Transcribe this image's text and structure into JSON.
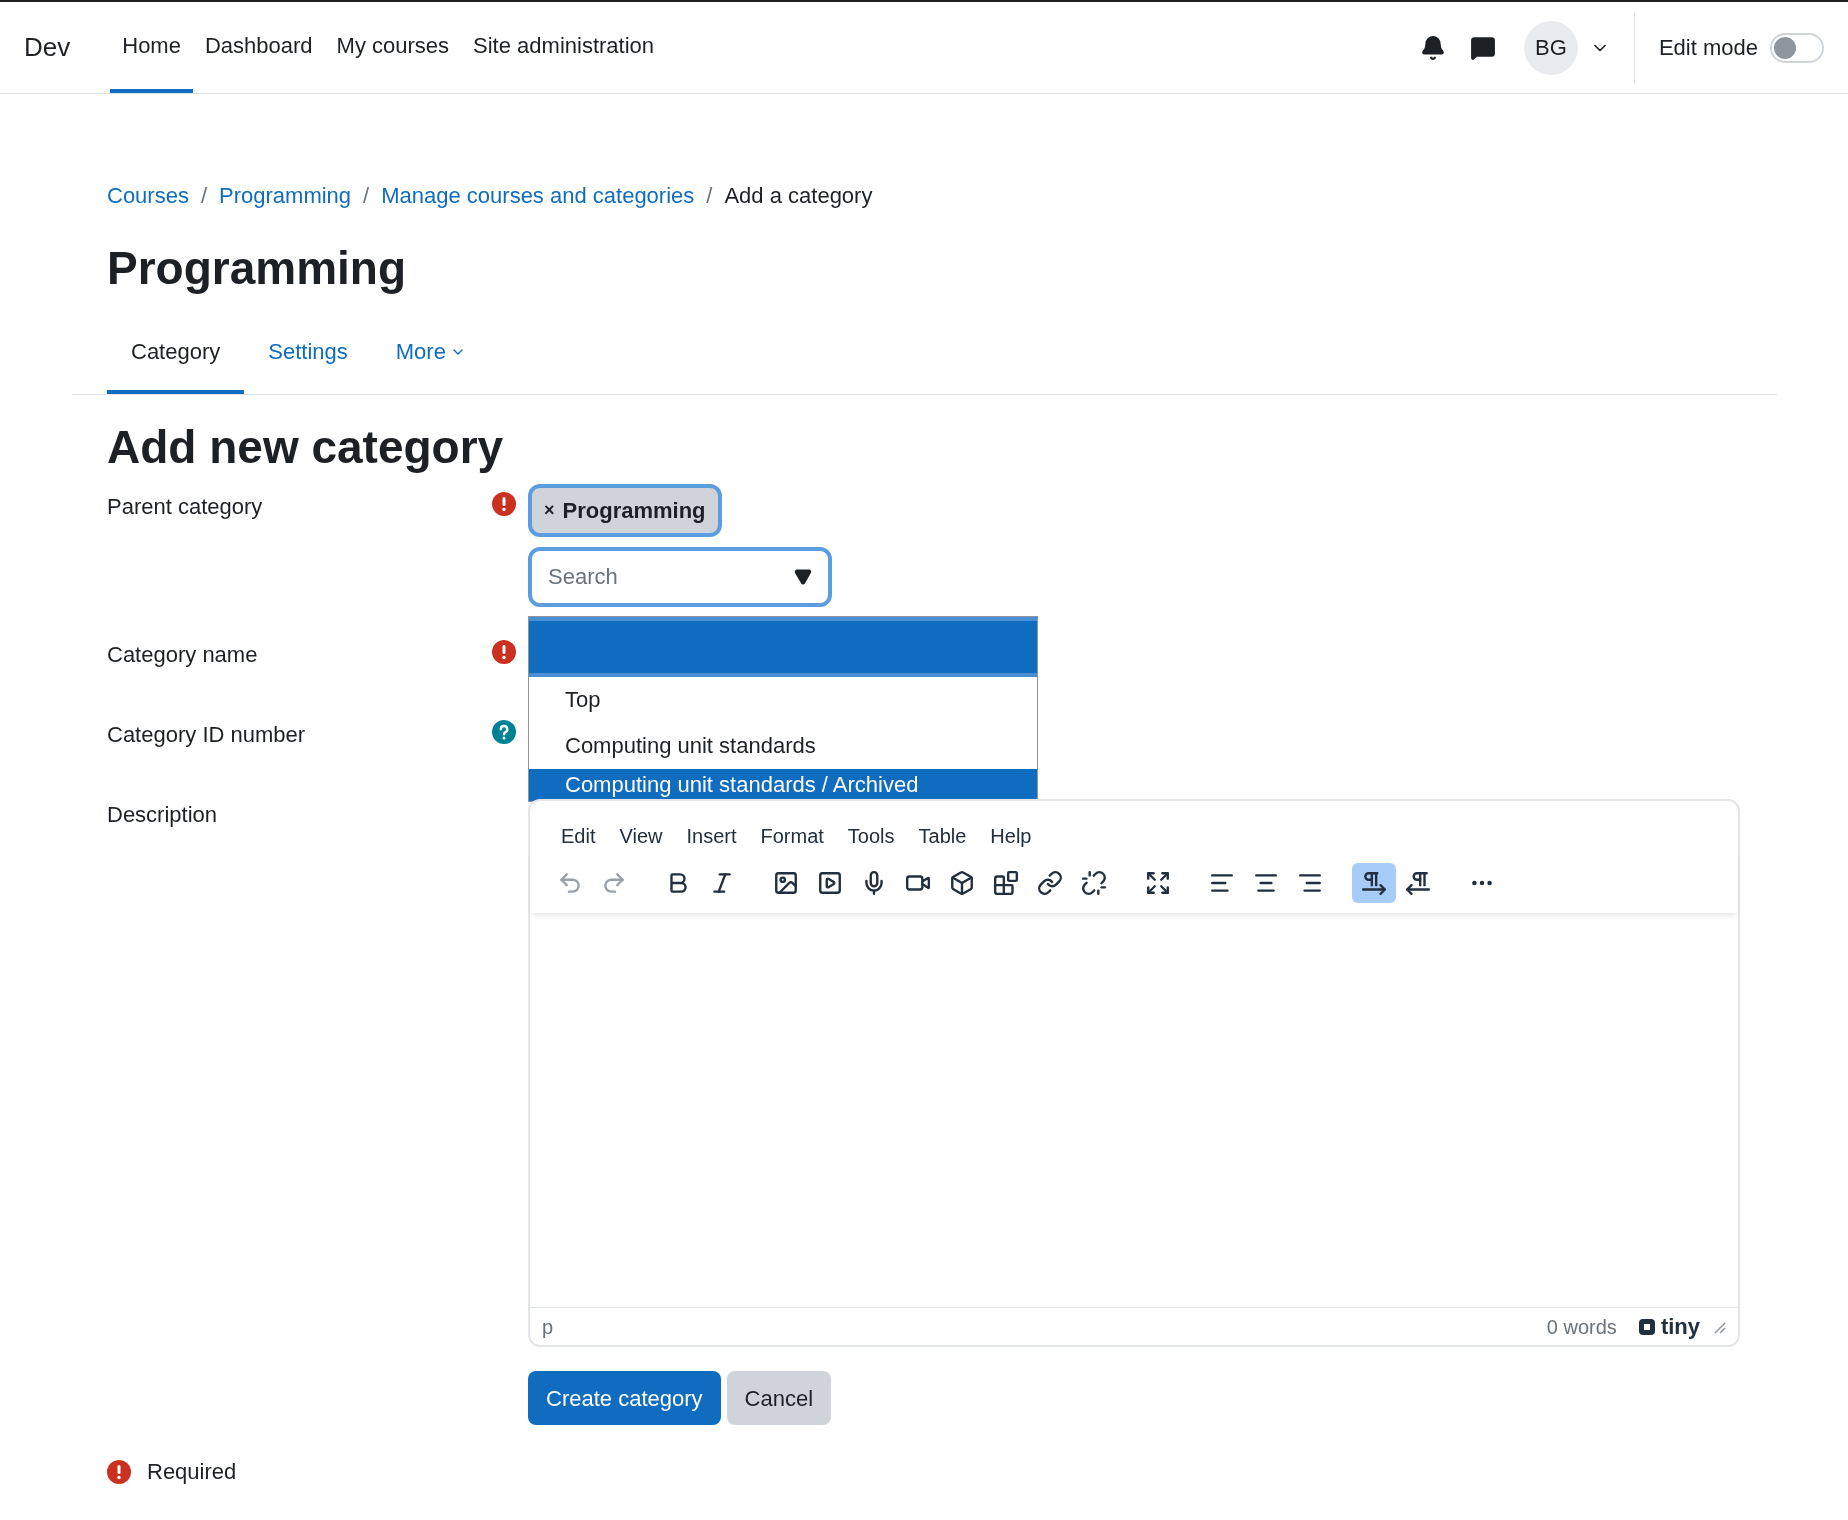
{
  "header": {
    "brand": "Dev",
    "nav": [
      {
        "label": "Home",
        "selected": true
      },
      {
        "label": "Dashboard",
        "selected": false
      },
      {
        "label": "My courses",
        "selected": false
      },
      {
        "label": "Site administration",
        "selected": false
      }
    ],
    "avatar": "BG",
    "edit_mode": {
      "label": "Edit mode",
      "on": false
    }
  },
  "breadcrumb": [
    {
      "label": "Courses",
      "kind": "link"
    },
    {
      "label": "/",
      "kind": "separator"
    },
    {
      "label": "Programming",
      "kind": "link"
    },
    {
      "label": "/",
      "kind": "separator"
    },
    {
      "label": "Manage courses and categories",
      "kind": "link"
    },
    {
      "label": "/",
      "kind": "separator"
    },
    {
      "label": "Add a category",
      "kind": "current"
    }
  ],
  "page_title": "Programming",
  "tabs": [
    {
      "label": "Category",
      "selected": true,
      "kind": "plain"
    },
    {
      "label": "Settings",
      "selected": false,
      "kind": "plain"
    },
    {
      "label": "More",
      "selected": false,
      "kind": "dropdown"
    }
  ],
  "form_heading": "Add new category",
  "fields": [
    {
      "label": "Parent category",
      "kind": "required"
    },
    {
      "label": "Category name",
      "kind": "required"
    },
    {
      "label": "Category ID number",
      "kind": "help"
    },
    {
      "label": "Description",
      "kind": "none"
    }
  ],
  "parent_select": {
    "chip": "Programming",
    "chip_remove": "×",
    "placeholder": "Search",
    "options": [
      {
        "selected": true
      },
      {
        "label": "Top",
        "selected": false
      },
      {
        "label": "Computing unit standards",
        "selected": false
      },
      {
        "label": "Computing unit standards / Archived",
        "selected": true
      }
    ]
  },
  "editor": {
    "menu": [
      "Edit",
      "View",
      "Insert",
      "Format",
      "Tools",
      "Table",
      "Help"
    ],
    "toolbar": {
      "undo_disabled": true,
      "redo_disabled": true,
      "ltr_selected": true
    },
    "path": "p",
    "word_count": "0 words",
    "brand": "tiny"
  },
  "buttons": [
    {
      "label": "Create category",
      "kind": "primary"
    },
    {
      "label": "Cancel",
      "kind": "secondary"
    }
  ],
  "required_note": "Required"
}
